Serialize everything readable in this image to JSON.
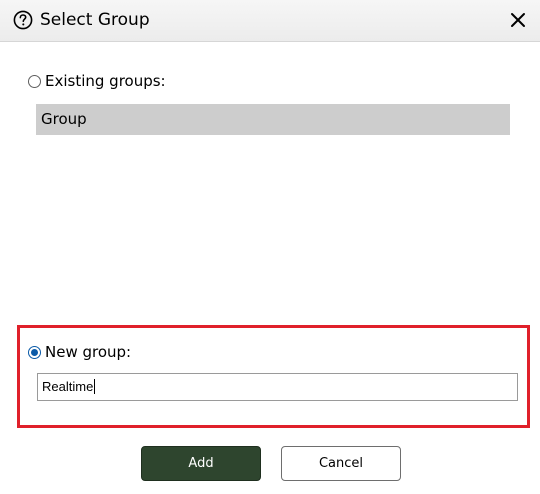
{
  "dialog": {
    "title": "Select Group",
    "help_icon": "question-circle-icon",
    "close_icon": "close-icon"
  },
  "existing": {
    "label": "Existing groups:",
    "selected": false,
    "items": [
      "Group"
    ]
  },
  "new_group": {
    "label": "New group:",
    "selected": true,
    "input_value": "Realtime"
  },
  "buttons": {
    "add_label": "Add",
    "cancel_label": "Cancel"
  },
  "colors": {
    "highlight": "#e0202a",
    "primary_button": "#2e452e",
    "radio_selected": "#0a5aa8",
    "list_background": "#cdcdcd"
  }
}
